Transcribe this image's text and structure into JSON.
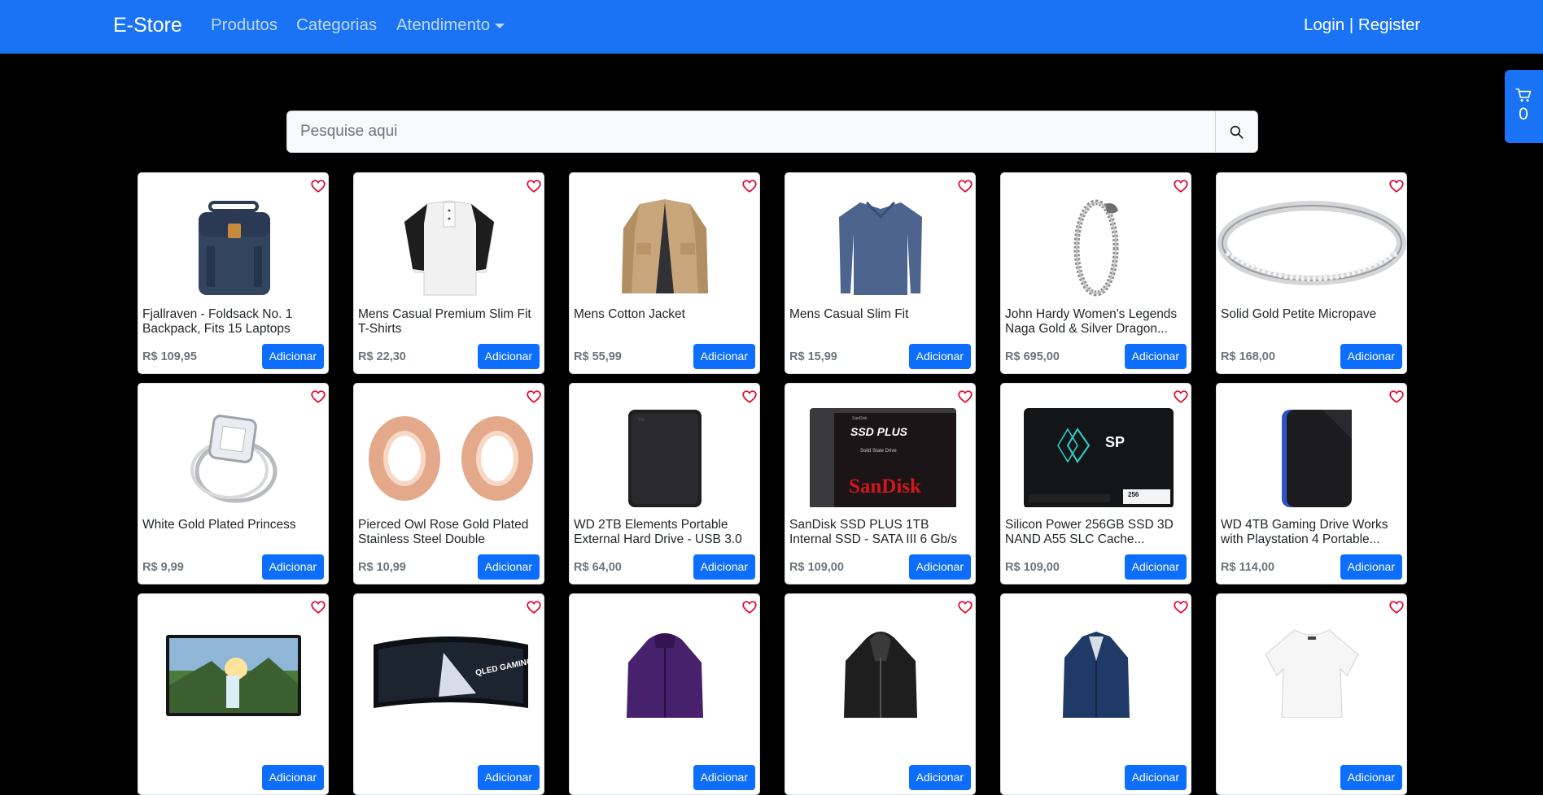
{
  "navbar": {
    "brand": "E-Store",
    "links": [
      "Produtos",
      "Categorias",
      "Atendimento"
    ],
    "login": "Login",
    "separator": "|",
    "register": "Register"
  },
  "cart": {
    "count": "0"
  },
  "search": {
    "placeholder": "Pesquise aqui",
    "value": ""
  },
  "add_label": "Adicionar",
  "products": [
    {
      "title": "Fjallraven - Foldsack No. 1 Backpack, Fits 15 Laptops",
      "price": "R$ 109,95"
    },
    {
      "title": "Mens Casual Premium Slim Fit T-Shirts",
      "price": "R$ 22,30"
    },
    {
      "title": "Mens Cotton Jacket",
      "price": "R$ 55,99"
    },
    {
      "title": "Mens Casual Slim Fit",
      "price": "R$ 15,99"
    },
    {
      "title": "John Hardy Women's Legends Naga Gold & Silver Dragon...",
      "price": "R$ 695,00"
    },
    {
      "title": "Solid Gold Petite Micropave",
      "price": "R$ 168,00"
    },
    {
      "title": "White Gold Plated Princess",
      "price": "R$ 9,99"
    },
    {
      "title": "Pierced Owl Rose Gold Plated Stainless Steel Double",
      "price": "R$ 10,99"
    },
    {
      "title": "WD 2TB Elements Portable External Hard Drive - USB 3.0",
      "price": "R$ 64,00"
    },
    {
      "title": "SanDisk SSD PLUS 1TB Internal SSD - SATA III 6 Gb/s",
      "price": "R$ 109,00"
    },
    {
      "title": "Silicon Power 256GB SSD 3D NAND A55 SLC Cache...",
      "price": "R$ 109,00"
    },
    {
      "title": "WD 4TB Gaming Drive Works with Playstation 4 Portable...",
      "price": "R$ 114,00"
    },
    {
      "title": "",
      "price": ""
    },
    {
      "title": "",
      "price": ""
    },
    {
      "title": "",
      "price": ""
    },
    {
      "title": "",
      "price": ""
    },
    {
      "title": "",
      "price": ""
    },
    {
      "title": "",
      "price": ""
    }
  ],
  "product_images": [
    "backpack-image",
    "raglan-tshirt-image",
    "cotton-jacket-image",
    "slim-fit-shirt-image",
    "dragon-bracelet-image",
    "micropave-ring-image",
    "princess-ring-image",
    "rose-gold-plugs-image",
    "wd-2tb-drive-image",
    "sandisk-ssd-image",
    "silicon-power-ssd-image",
    "wd-4tb-drive-image",
    "monitor-image",
    "curved-monitor-image",
    "purple-jacket-image",
    "black-leather-jacket-image",
    "navy-coat-image",
    "white-top-image"
  ],
  "image_text": {
    "sandisk_label": "SSD PLUS",
    "sandisk_sub": "Solid State Drive",
    "sandisk_brand": "SanDisk",
    "sandisk_top": "SanDisk",
    "sp_logo": "SP",
    "sp_capacity": "256",
    "monitor_text": "QLED GAMING MONITOR"
  },
  "colors": {
    "navbar": "#1a73f5",
    "button": "#0d6efd",
    "heart": "#e4002b",
    "background": "#000000"
  }
}
